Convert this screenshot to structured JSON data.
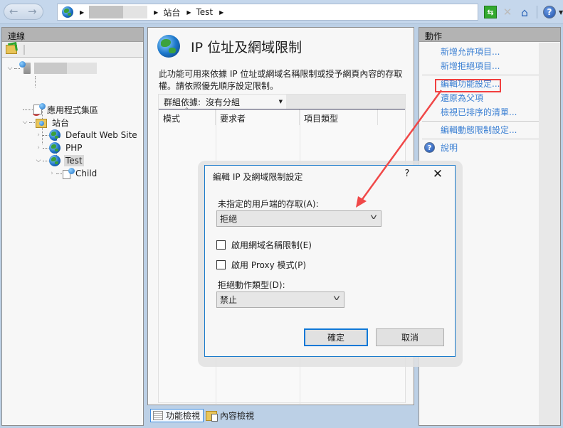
{
  "address_bar": {
    "crumbs": [
      "站台",
      "Test"
    ],
    "redacted_server_name": true
  },
  "toolbar": {
    "icons": [
      "refresh-icon",
      "stop-icon",
      "home-icon",
      "help-icon"
    ]
  },
  "connections": {
    "title": "連線",
    "tree": [
      {
        "label": "",
        "type": "server",
        "redacted": true,
        "expanded": true
      },
      {
        "label": "應用程式集區",
        "type": "app-pools"
      },
      {
        "label": "站台",
        "type": "sites",
        "expanded": true
      },
      {
        "label": "Default Web Site",
        "type": "site",
        "expanded": false
      },
      {
        "label": "PHP",
        "type": "site",
        "expanded": false
      },
      {
        "label": "Test",
        "type": "site",
        "expanded": true,
        "selected": true
      },
      {
        "label": "Child",
        "type": "application",
        "expanded": false
      }
    ]
  },
  "feature": {
    "title": "IP 位址及網域限制",
    "description": "此功能可用來依據 IP 位址或網域名稱限制或授予網頁內容的存取權。請依照優先順序設定限制。",
    "group_by_label": "群組依據:",
    "group_by_value": "沒有分組",
    "columns": [
      "模式",
      "要求者",
      "項目類型"
    ],
    "rows": []
  },
  "view_tabs": {
    "features_view": "功能檢視",
    "content_view": "內容檢視"
  },
  "actions": {
    "title": "動作",
    "groups": [
      [
        "新增允許項目...",
        "新增拒絕項目..."
      ],
      [
        "編輯功能設定...",
        "還原為父項",
        "檢視已排序的清單..."
      ],
      [
        "編輯動態限制設定..."
      ]
    ],
    "help": "說明",
    "highlighted": "編輯功能設定..."
  },
  "dialog": {
    "title": "編輯 IP 及網域限制設定",
    "help_glyph": "?",
    "close_glyph": "✕",
    "access_label": "未指定的用戶端的存取(A):",
    "access_value": "拒絕",
    "enable_domain_label": "啟用網域名稱限制(E)",
    "enable_domain_checked": false,
    "enable_proxy_label": "啟用 Proxy 模式(P)",
    "enable_proxy_checked": false,
    "deny_action_label": "拒絕動作類型(D):",
    "deny_action_value": "禁止",
    "ok_label": "確定",
    "cancel_label": "取消"
  },
  "annotation": {
    "arrow_color": "#f04848",
    "highlight_color": "#f14040"
  }
}
